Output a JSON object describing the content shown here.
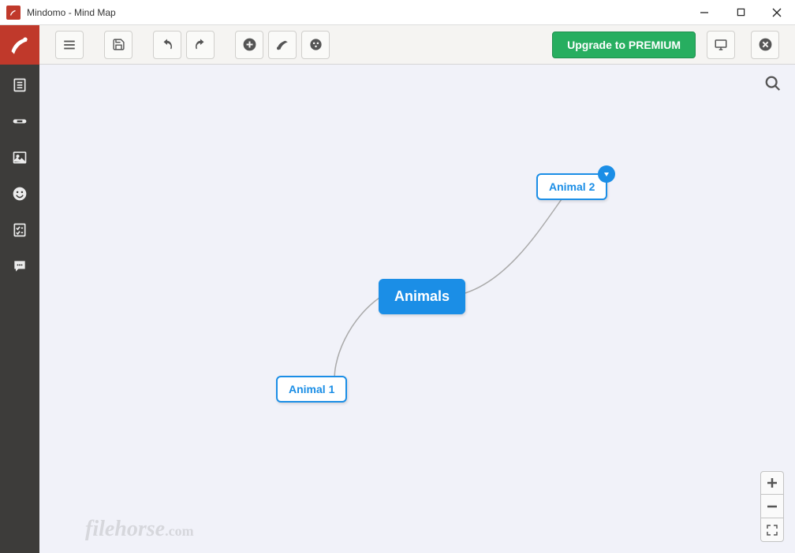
{
  "window": {
    "title": "Mindomo - Mind Map"
  },
  "toolbar": {
    "upgrade_label": "Upgrade to PREMIUM"
  },
  "mindmap": {
    "root": "Animals",
    "child1": "Animal 1",
    "child2": "Animal 2"
  },
  "watermark": {
    "text": "filehorse",
    "suffix": ".com"
  }
}
